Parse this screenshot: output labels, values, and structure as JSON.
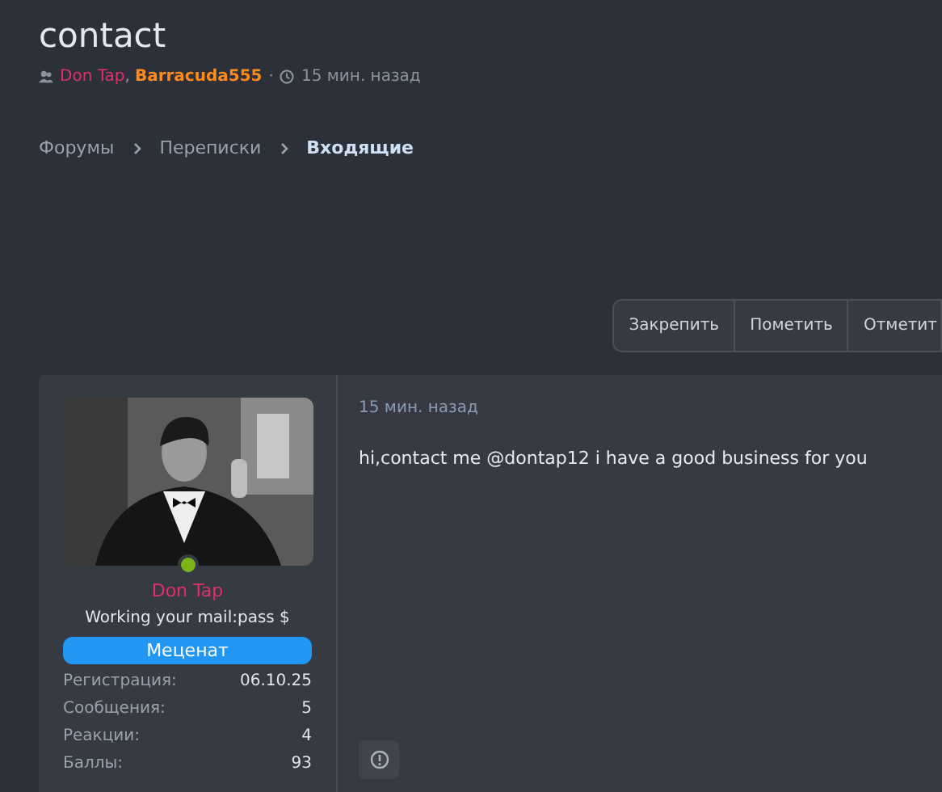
{
  "thread": {
    "title": "contact",
    "participants": [
      {
        "name": "Don Tap",
        "color": "#e0306a"
      },
      {
        "name": "Barracuda555",
        "color": "#ff8a1c"
      }
    ],
    "separator": ",",
    "divider": "·",
    "time": "15 мин. назад"
  },
  "breadcrumbs": [
    {
      "label": "Форумы",
      "current": false
    },
    {
      "label": "Переписки",
      "current": false
    },
    {
      "label": "Входящие",
      "current": true
    }
  ],
  "actions": [
    "Закрепить",
    "Пометить",
    "Отметит"
  ],
  "post": {
    "author": {
      "name": "Don Tap",
      "color": "#e0306a",
      "online": true,
      "title": "Working your mail:pass $",
      "banner": "Меценат",
      "stats": [
        {
          "label": "Регистрация:",
          "value": "06.10.25"
        },
        {
          "label": "Сообщения:",
          "value": "5"
        },
        {
          "label": "Реакции:",
          "value": "4"
        },
        {
          "label": "Баллы:",
          "value": "93"
        }
      ]
    },
    "time": "15 мин. назад",
    "text": "hi,contact me @dontap12 i have a good business for you"
  }
}
